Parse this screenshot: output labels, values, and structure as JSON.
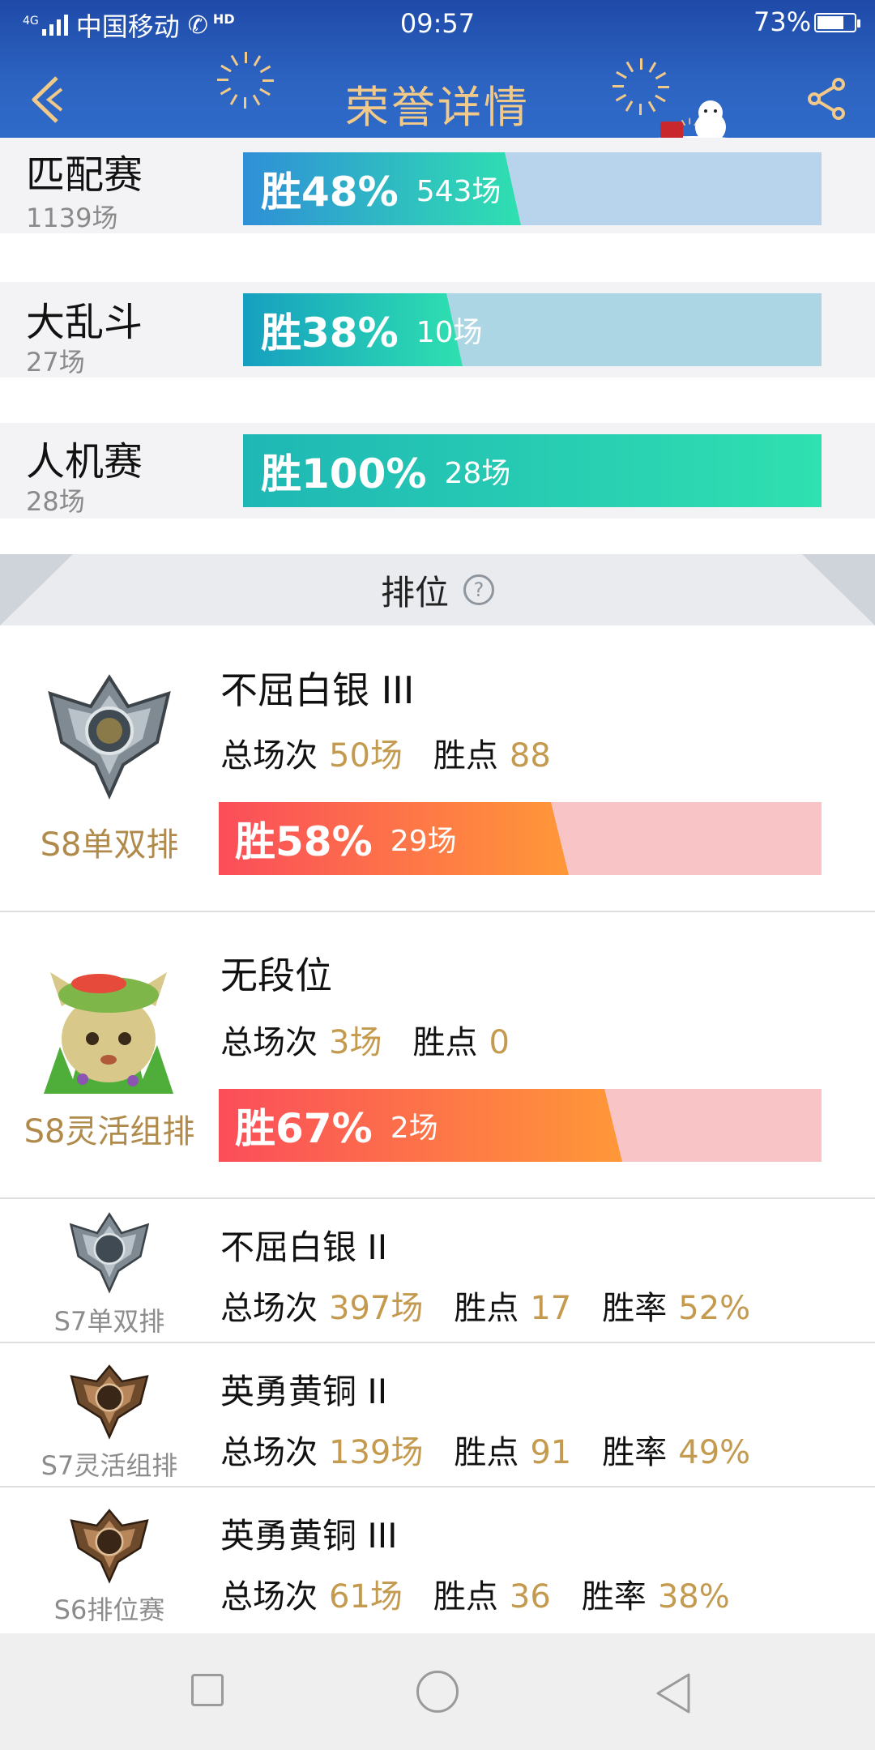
{
  "status_bar": {
    "carrier": "中国移动",
    "network": "4G",
    "hd": "HD",
    "time": "09:57",
    "battery_percent": "73%",
    "battery_level": 0.73
  },
  "header": {
    "title": "荣誉详情",
    "back_icon": "chevron-left-icon",
    "share_icon": "share-icon"
  },
  "matches": [
    {
      "name": "匹配赛",
      "total": "1139场",
      "win_label": "胜48%",
      "games": "543场",
      "win_fraction": 0.48,
      "bar_color": "#2f8fd7",
      "track_color": "#b8d4ec"
    },
    {
      "name": "大乱斗",
      "total": "27场",
      "win_label": "胜38%",
      "games": "10场",
      "win_fraction": 0.38,
      "bar_color": "#169fc0",
      "track_color": "#acd6e3"
    },
    {
      "name": "人机赛",
      "total": "28场",
      "win_label": "胜100%",
      "games": "28场",
      "win_fraction": 1.0,
      "bar_color": "#1fb7b5",
      "track_color": "#a9e6dc"
    }
  ],
  "ranked_section": {
    "title": "排位",
    "help_icon": "help-icon"
  },
  "ranked": [
    {
      "season": "S8单双排",
      "tier": "不屈白银 III",
      "total_label": "总场次",
      "total": "50场",
      "points_label": "胜点",
      "points": "88",
      "win_label": "胜58%",
      "games": "29场",
      "win_fraction": 0.58,
      "emblem": "silver-emblem-icon"
    },
    {
      "season": "S8灵活组排",
      "tier": "无段位",
      "total_label": "总场次",
      "total": "3场",
      "points_label": "胜点",
      "points": "0",
      "win_label": "胜67%",
      "games": "2场",
      "win_fraction": 0.67,
      "emblem": "teemo-avatar-icon"
    }
  ],
  "history": [
    {
      "season": "S7单双排",
      "tier": "不屈白银 II",
      "total_label": "总场次",
      "total": "397场",
      "points_label": "胜点",
      "points": "17",
      "rate_label": "胜率",
      "rate": "52%",
      "emblem": "silver-emblem-icon"
    },
    {
      "season": "S7灵活组排",
      "tier": "英勇黄铜 II",
      "total_label": "总场次",
      "total": "139场",
      "points_label": "胜点",
      "points": "91",
      "rate_label": "胜率",
      "rate": "49%",
      "emblem": "bronze-emblem-icon"
    },
    {
      "season": "S6排位赛",
      "tier": "英勇黄铜 III",
      "total_label": "总场次",
      "total": "61场",
      "points_label": "胜点",
      "points": "36",
      "rate_label": "胜率",
      "rate": "38%",
      "emblem": "bronze-emblem-icon"
    }
  ],
  "nav": {
    "recents_icon": "square-icon",
    "home_icon": "circle-icon",
    "back_icon": "triangle-back-icon"
  }
}
